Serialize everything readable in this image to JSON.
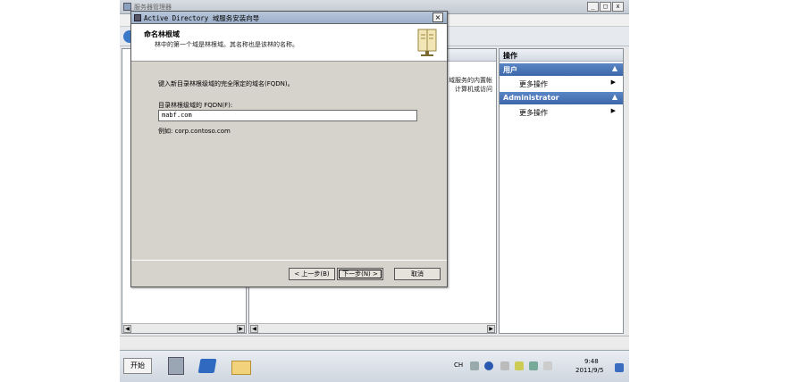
{
  "background_window": {
    "title": "服务器管理器",
    "center_description_line1": "域服务的内置帐",
    "center_description_line2": "计算机或访问"
  },
  "actions_pane": {
    "header": "操作",
    "sections": [
      {
        "title": "用户",
        "item": "更多操作"
      },
      {
        "title": "Administrator",
        "item": "更多操作"
      }
    ]
  },
  "dialog": {
    "title": "Active Directory 域服务安装向导",
    "close_glyph": "×",
    "heading": "命名林根域",
    "subheading": "林中的第一个域是林根域。其名称也是该林的名称。",
    "prompt": "键入新目录林根级域的完全限定的域名(FQDN)。",
    "fqdn_label": "目录林根级域的 FQDN(F):",
    "fqdn_value": "mabf.com",
    "example": "例如: corp.contoso.com",
    "buttons": {
      "back": "< 上一步(B)",
      "next": "下一步(N) >",
      "cancel": "取消"
    }
  },
  "taskbar": {
    "start_label": "开始",
    "ime": "CH",
    "time": "9:48",
    "date": "2011/9/5"
  },
  "colors": {
    "dialog_body": "#d6d3cc",
    "section_header": "#3c67a8",
    "title_bar": "#9db0ca"
  }
}
